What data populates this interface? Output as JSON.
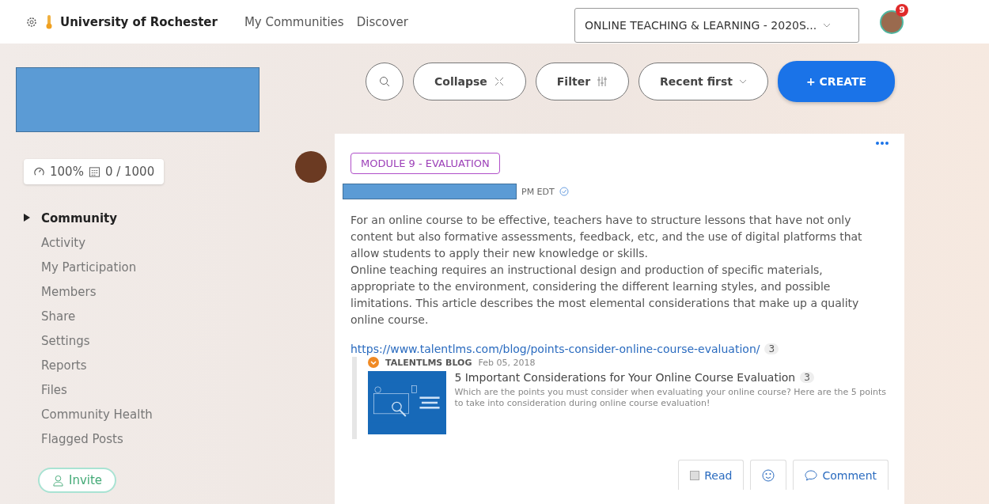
{
  "top_bar": {
    "org": "University of Rochester",
    "links": [
      "My Communities",
      "Discover"
    ],
    "community_select": "ONLINE TEACHING & LEARNING - 2020S...",
    "notification_count": "9"
  },
  "sidebar": {
    "stats": {
      "progress": "100%",
      "members": "0 / 1000"
    },
    "nav": [
      {
        "label": "Community",
        "selected": true
      },
      {
        "label": "Activity",
        "selected": false
      },
      {
        "label": "My Participation",
        "selected": false
      },
      {
        "label": "Members",
        "selected": false
      },
      {
        "label": "Share",
        "selected": false
      },
      {
        "label": "Settings",
        "selected": false
      },
      {
        "label": "Reports",
        "selected": false
      },
      {
        "label": "Files",
        "selected": false
      },
      {
        "label": "Community Health",
        "selected": false
      },
      {
        "label": "Flagged Posts",
        "selected": false
      }
    ],
    "invite": "Invite"
  },
  "toolbar": {
    "collapse": "Collapse",
    "filter": "Filter",
    "sort": "Recent first",
    "create": "+ CREATE"
  },
  "post": {
    "tag": "MODULE 9 - EVALUATION",
    "time": "PM EDT",
    "paragraphs": [
      "For an online course to be effective, teachers have to structure lessons that have not only content but also formative assessments, feedback, etc, and the use of digital platforms that allow students to apply their new knowledge or skills.",
      "Online teaching requires an instructional design and production of specific materials, appropriate to the environment, considering the different learning styles, and possible limitations. This article describes the most elemental considerations that make up a quality online course."
    ],
    "link": {
      "url": "https://www.talentlms.com/blog/points-consider-online-course-evaluation/",
      "url_count": "3",
      "source": "TALENTLMS BLOG",
      "date": "Feb 05, 2018",
      "title": "5 Important Considerations for Your Online Course Evaluation",
      "title_count": "3",
      "description": "Which are the points you must consider when evaluating your online course? Here are the 5 points to take into consideration during online course evaluation!"
    },
    "actions": {
      "read": {
        "label": "Read",
        "checked": false
      },
      "comment": "Comment"
    }
  }
}
